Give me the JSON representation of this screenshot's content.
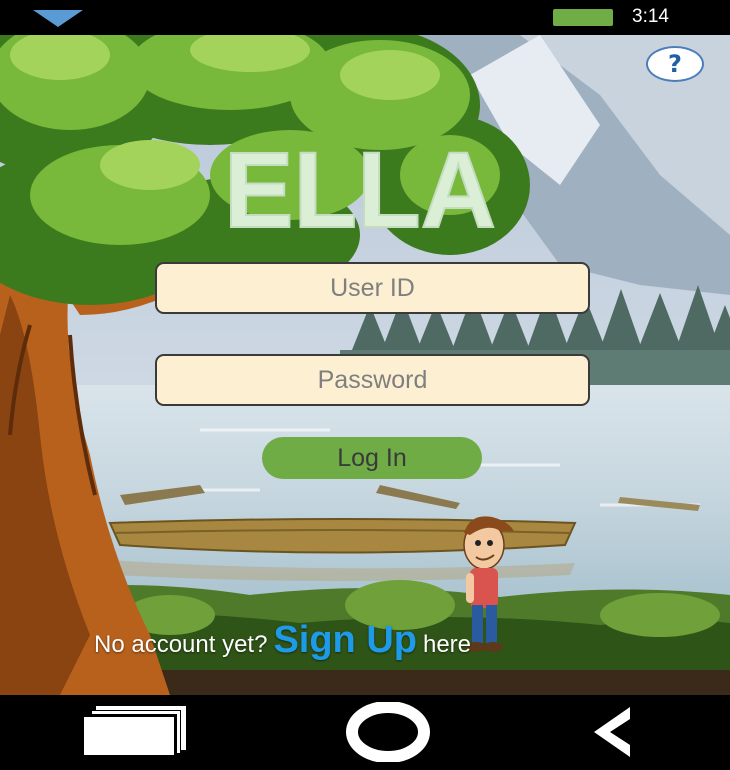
{
  "status_bar": {
    "time": "3:14",
    "battery_color": "#70ad47"
  },
  "header": {
    "help_label": "?"
  },
  "app": {
    "logo_text": "ELLA"
  },
  "login_form": {
    "user_id_placeholder": "User ID",
    "password_placeholder": "Password",
    "login_label": "Log In"
  },
  "signup": {
    "prefix": "No account yet?",
    "link_label": "Sign Up",
    "suffix": "here"
  },
  "nav_bar": {
    "icons": [
      "recent-apps-icon",
      "home-icon",
      "back-icon"
    ]
  },
  "colors": {
    "accent_green": "#6fac46",
    "link_blue": "#1e9be8",
    "field_bg": "#fdf0d2"
  }
}
